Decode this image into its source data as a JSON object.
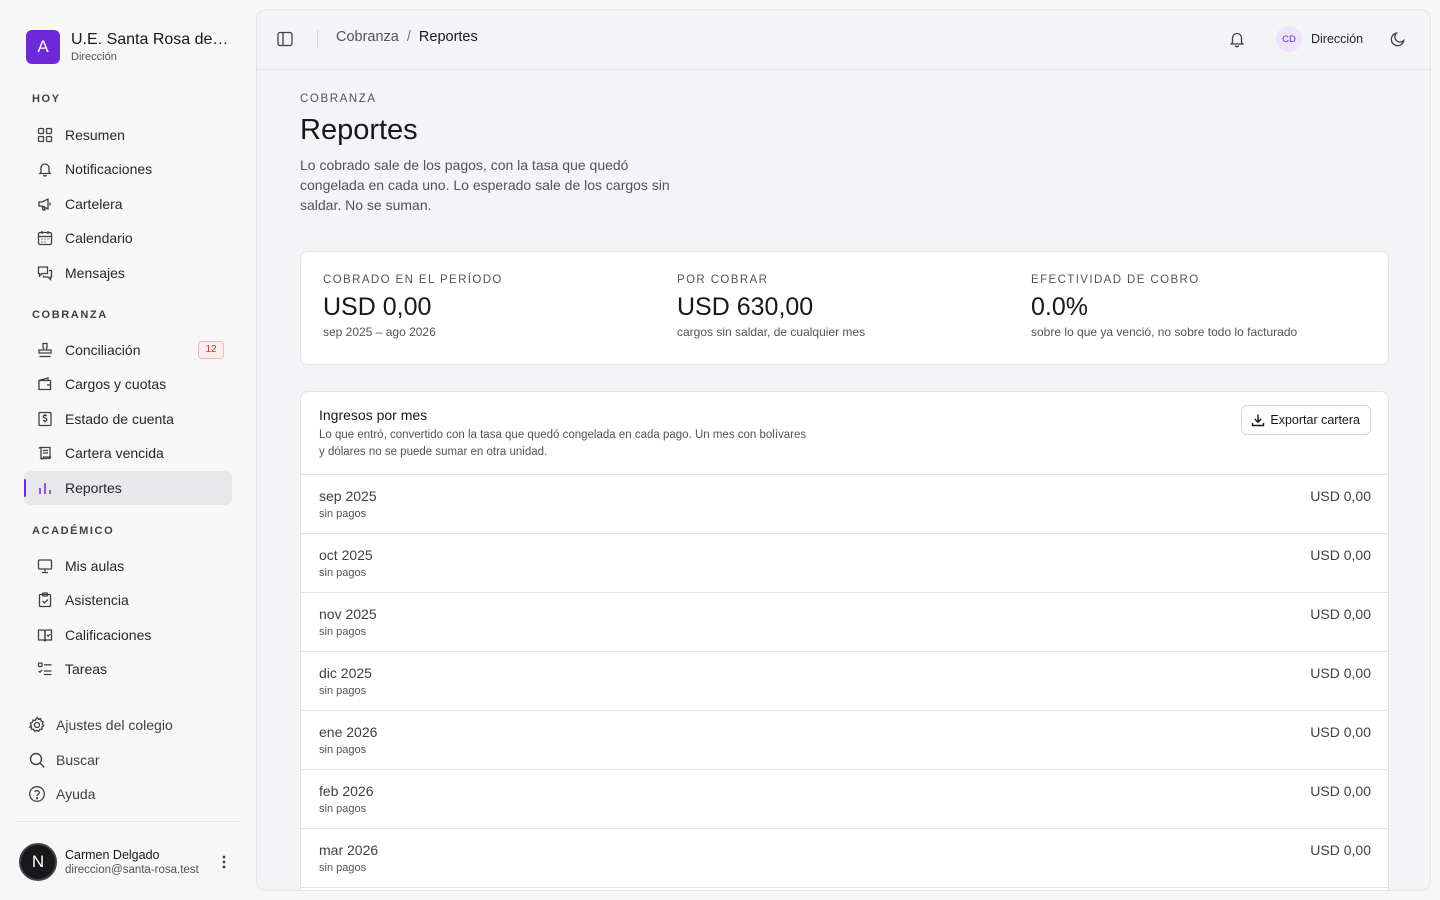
{
  "org": {
    "logo_letter": "A",
    "name": "U.E. Santa Rosa de Lima",
    "role": "Dirección"
  },
  "sidebar": {
    "sections": [
      {
        "label": "HOY",
        "items": [
          {
            "label": "Resumen",
            "icon": "grid-icon"
          },
          {
            "label": "Notificaciones",
            "icon": "bell-icon"
          },
          {
            "label": "Cartelera",
            "icon": "megaphone-icon"
          },
          {
            "label": "Calendario",
            "icon": "calendar-icon"
          },
          {
            "label": "Mensajes",
            "icon": "messages-icon"
          }
        ]
      },
      {
        "label": "COBRANZA",
        "items": [
          {
            "label": "Conciliación",
            "icon": "stamp-icon",
            "badge": "12"
          },
          {
            "label": "Cargos y cuotas",
            "icon": "wallet-icon"
          },
          {
            "label": "Estado de cuenta",
            "icon": "receipt-dollar-icon"
          },
          {
            "label": "Cartera vencida",
            "icon": "scroll-icon"
          },
          {
            "label": "Reportes",
            "icon": "bar-chart-icon",
            "active": true
          }
        ]
      },
      {
        "label": "ACADÉMICO",
        "items": [
          {
            "label": "Mis aulas",
            "icon": "presentation-icon"
          },
          {
            "label": "Asistencia",
            "icon": "clipboard-check-icon"
          },
          {
            "label": "Calificaciones",
            "icon": "book-check-icon"
          },
          {
            "label": "Tareas",
            "icon": "list-todo-icon"
          }
        ]
      }
    ],
    "bottom": [
      {
        "label": "Ajustes del colegio",
        "icon": "gear-icon"
      },
      {
        "label": "Buscar",
        "icon": "search-icon"
      },
      {
        "label": "Ayuda",
        "icon": "help-icon"
      }
    ]
  },
  "user": {
    "initial": "N",
    "name": "Carmen Delgado",
    "email": "direccion@santa-rosa.test"
  },
  "topbar": {
    "breadcrumb_parent": "Cobranza",
    "breadcrumb_sep": "/",
    "breadcrumb_current": "Reportes",
    "me_initials": "CD",
    "me_label": "Dirección"
  },
  "page": {
    "eyebrow": "COBRANZA",
    "title": "Reportes",
    "description": "Lo cobrado sale de los pagos, con la tasa que quedó congelada en cada uno. Lo esperado sale de los cargos sin saldar. No se suman."
  },
  "stats": [
    {
      "label": "COBRADO EN EL PERÍODO",
      "value": "USD 0,00",
      "sub": "sep 2025 – ago 2026"
    },
    {
      "label": "POR COBRAR",
      "value": "USD 630,00",
      "sub": "cargos sin saldar, de cualquier mes"
    },
    {
      "label": "EFECTIVIDAD DE COBRO",
      "value": "0.0%",
      "sub": "sobre lo que ya venció, no sobre todo lo facturado"
    }
  ],
  "income": {
    "title": "Ingresos por mes",
    "description": "Lo que entró, convertido con la tasa que quedó congelada en cada pago. Un mes con bolívares y dólares no se puede sumar en otra unidad.",
    "export_label": "Exportar cartera",
    "months": [
      {
        "month": "sep 2025",
        "note": "sin pagos",
        "amount": "USD 0,00"
      },
      {
        "month": "oct 2025",
        "note": "sin pagos",
        "amount": "USD 0,00"
      },
      {
        "month": "nov 2025",
        "note": "sin pagos",
        "amount": "USD 0,00"
      },
      {
        "month": "dic 2025",
        "note": "sin pagos",
        "amount": "USD 0,00"
      },
      {
        "month": "ene 2026",
        "note": "sin pagos",
        "amount": "USD 0,00"
      },
      {
        "month": "feb 2026",
        "note": "sin pagos",
        "amount": "USD 0,00"
      },
      {
        "month": "mar 2026",
        "note": "sin pagos",
        "amount": "USD 0,00"
      }
    ]
  },
  "colors": {
    "accent": "#6d28d9",
    "badge_text": "#c0392b",
    "badge_bg": "#fdecec"
  }
}
